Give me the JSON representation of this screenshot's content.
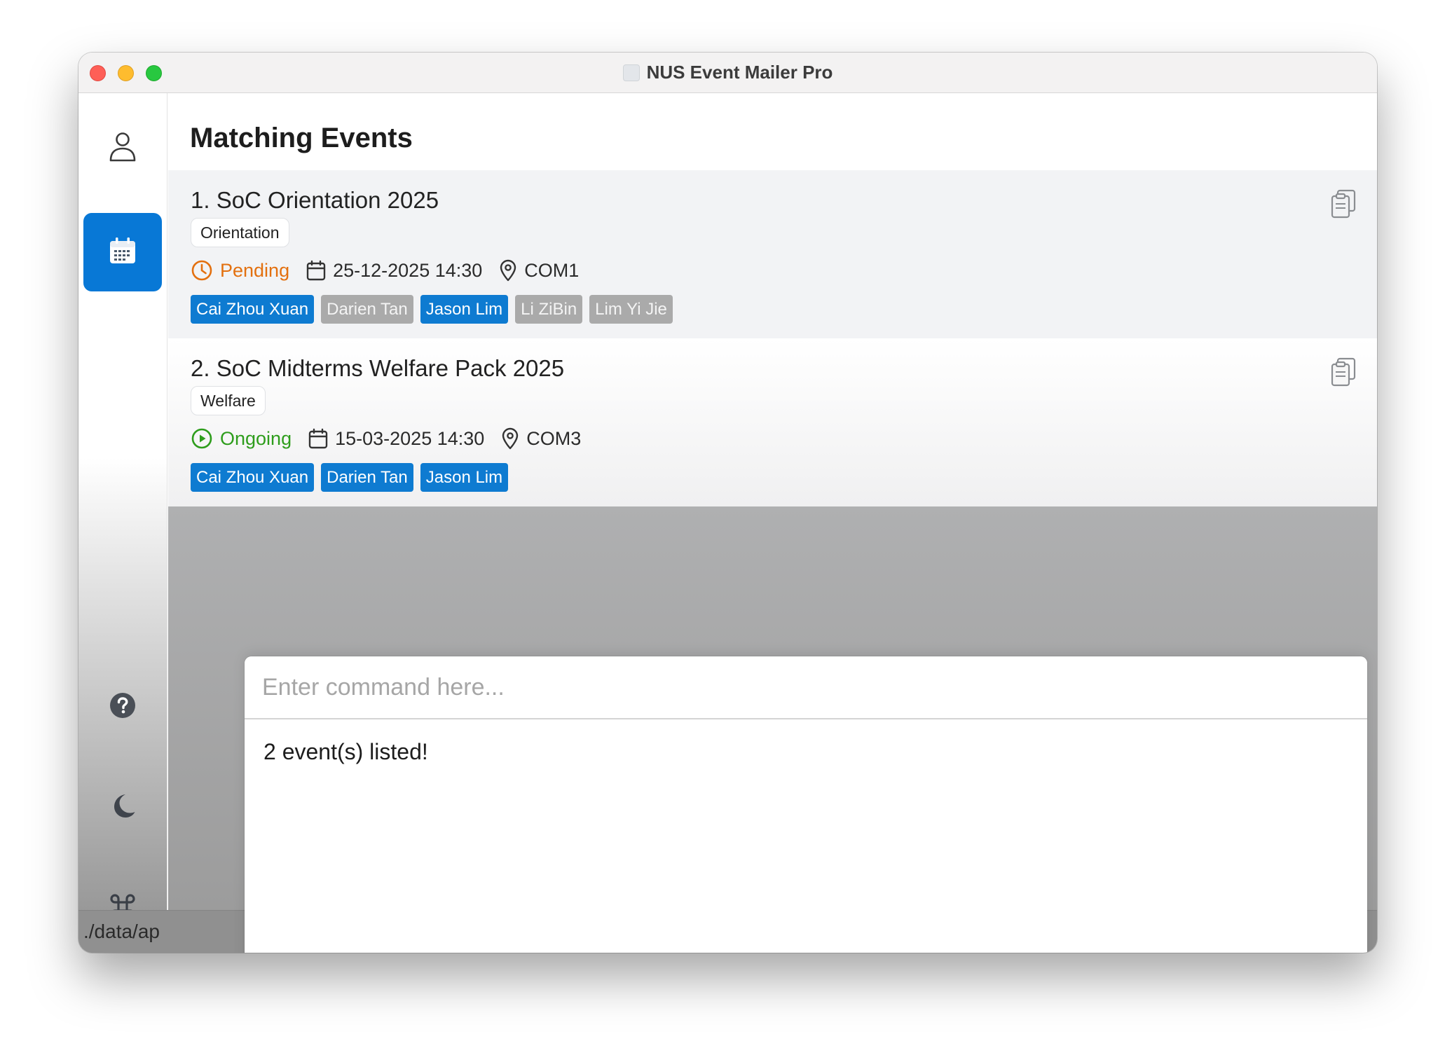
{
  "window": {
    "title": "NUS Event Mailer Pro"
  },
  "sidebar": {
    "items": [
      {
        "icon": "person-icon",
        "active": false
      },
      {
        "icon": "calendar-icon",
        "active": true
      },
      {
        "icon": "help-icon",
        "active": false
      },
      {
        "icon": "moon-icon",
        "active": false
      },
      {
        "icon": "command-icon",
        "active": false
      }
    ]
  },
  "main": {
    "heading": "Matching Events",
    "events": [
      {
        "title": "1. SoC Orientation 2025",
        "tag": "Orientation",
        "status": "Pending",
        "datetime": "25-12-2025 14:30",
        "location": "COM1",
        "people": [
          {
            "name": "Cai Zhou Xuan",
            "active": true
          },
          {
            "name": "Darien Tan",
            "active": false
          },
          {
            "name": "Jason Lim",
            "active": true
          },
          {
            "name": "Li ZiBin",
            "active": false
          },
          {
            "name": "Lim Yi Jie",
            "active": false
          }
        ]
      },
      {
        "title": "2. SoC Midterms Welfare Pack 2025",
        "tag": "Welfare",
        "status": "Ongoing",
        "datetime": "15-03-2025 14:30",
        "location": "COM3",
        "people": [
          {
            "name": "Cai Zhou Xuan",
            "active": true
          },
          {
            "name": "Darien Tan",
            "active": true
          },
          {
            "name": "Jason Lim",
            "active": true
          }
        ]
      }
    ]
  },
  "command": {
    "placeholder": "Enter command here...",
    "value": "",
    "result": "2 event(s) listed!"
  },
  "status_bar": {
    "path": "./data/ap"
  },
  "colors": {
    "accent": "#0878d6",
    "person_active": "#0e7bd1",
    "person_inactive": "#aaaaaa",
    "status_pending": "#e3700f",
    "status_ongoing": "#2e9d1c"
  }
}
